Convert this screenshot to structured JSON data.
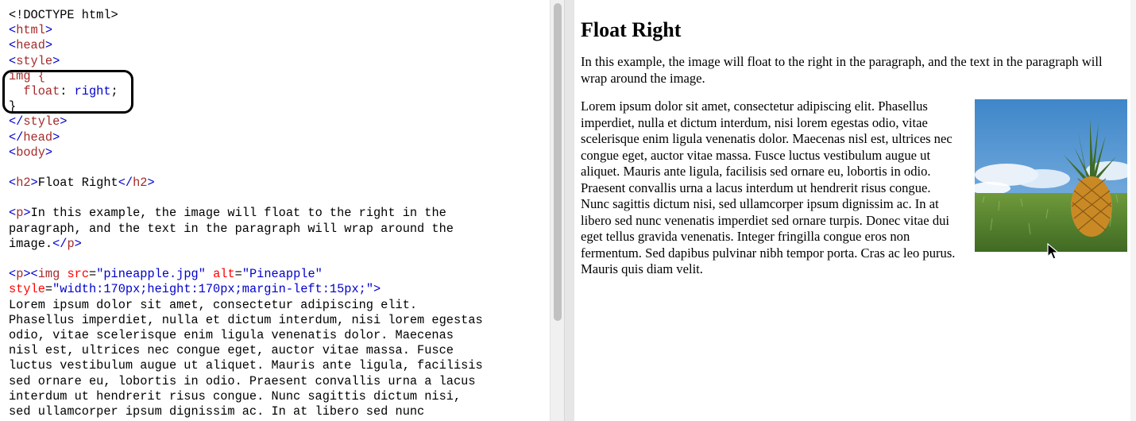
{
  "editor": {
    "lines": [
      [
        [
          "plain",
          "<!DOCTYPE html>"
        ]
      ],
      [
        [
          "br",
          "<"
        ],
        [
          "tag",
          "html"
        ],
        [
          "br",
          ">"
        ]
      ],
      [
        [
          "br",
          "<"
        ],
        [
          "tag",
          "head"
        ],
        [
          "br",
          ">"
        ]
      ],
      [
        [
          "br",
          "<"
        ],
        [
          "tag",
          "style"
        ],
        [
          "br",
          ">"
        ]
      ],
      [
        [
          "sel",
          "img {"
        ]
      ],
      [
        [
          "plain",
          "  "
        ],
        [
          "prop",
          "float"
        ],
        [
          "plain",
          ": "
        ],
        [
          "val",
          "right"
        ],
        [
          "plain",
          ";"
        ]
      ],
      [
        [
          "plain",
          "}"
        ]
      ],
      [
        [
          "br",
          "</"
        ],
        [
          "tag",
          "style"
        ],
        [
          "br",
          ">"
        ]
      ],
      [
        [
          "br",
          "</"
        ],
        [
          "tag",
          "head"
        ],
        [
          "br",
          ">"
        ]
      ],
      [
        [
          "br",
          "<"
        ],
        [
          "tag",
          "body"
        ],
        [
          "br",
          ">"
        ]
      ],
      [],
      [
        [
          "br",
          "<"
        ],
        [
          "tag",
          "h2"
        ],
        [
          "br",
          ">"
        ],
        [
          "plain",
          "Float Right"
        ],
        [
          "br",
          "</"
        ],
        [
          "tag",
          "h2"
        ],
        [
          "br",
          ">"
        ]
      ],
      [],
      [
        [
          "br",
          "<"
        ],
        [
          "tag",
          "p"
        ],
        [
          "br",
          ">"
        ],
        [
          "plain",
          "In this example, the image will float to the right in the"
        ]
      ],
      [
        [
          "plain",
          "paragraph, and the text in the paragraph will wrap around the"
        ]
      ],
      [
        [
          "plain",
          "image."
        ],
        [
          "br",
          "</"
        ],
        [
          "tag",
          "p"
        ],
        [
          "br",
          ">"
        ]
      ],
      [],
      [
        [
          "br",
          "<"
        ],
        [
          "tag",
          "p"
        ],
        [
          "br",
          "><"
        ],
        [
          "tag",
          "img"
        ],
        [
          "plain",
          " "
        ],
        [
          "attr",
          "src"
        ],
        [
          "plain",
          "="
        ],
        [
          "str",
          "\"pineapple.jpg\""
        ],
        [
          "plain",
          " "
        ],
        [
          "attr",
          "alt"
        ],
        [
          "plain",
          "="
        ],
        [
          "str",
          "\"Pineapple\""
        ]
      ],
      [
        [
          "attr",
          "style"
        ],
        [
          "plain",
          "="
        ],
        [
          "str",
          "\"width:170px;height:170px;margin-left:15px;\""
        ],
        [
          "br",
          ">"
        ]
      ],
      [
        [
          "plain",
          "Lorem ipsum dolor sit amet, consectetur adipiscing elit."
        ]
      ],
      [
        [
          "plain",
          "Phasellus imperdiet, nulla et dictum interdum, nisi lorem egestas"
        ]
      ],
      [
        [
          "plain",
          "odio, vitae scelerisque enim ligula venenatis dolor. Maecenas"
        ]
      ],
      [
        [
          "plain",
          "nisl est, ultrices nec congue eget, auctor vitae massa. Fusce"
        ]
      ],
      [
        [
          "plain",
          "luctus vestibulum augue ut aliquet. Mauris ante ligula, facilisis"
        ]
      ],
      [
        [
          "plain",
          "sed ornare eu, lobortis in odio. Praesent convallis urna a lacus"
        ]
      ],
      [
        [
          "plain",
          "interdum ut hendrerit risus congue. Nunc sagittis dictum nisi,"
        ]
      ],
      [
        [
          "plain",
          "sed ullamcorper ipsum dignissim ac. In at libero sed nunc"
        ]
      ]
    ]
  },
  "result": {
    "heading": "Float Right",
    "intro": "In this example, the image will float to the right in the paragraph, and the text in the paragraph will wrap around the image.",
    "lorem": "Lorem ipsum dolor sit amet, consectetur adipiscing elit. Phasellus imperdiet, nulla et dictum interdum, nisi lorem egestas odio, vitae scelerisque enim ligula venenatis dolor. Maecenas nisl est, ultrices nec congue eget, auctor vitae massa. Fusce luctus vestibulum augue ut aliquet. Mauris ante ligula, facilisis sed ornare eu, lobortis in odio. Praesent convallis urna a lacus interdum ut hendrerit risus congue. Nunc sagittis dictum nisi, sed ullamcorper ipsum dignissim ac. In at libero sed nunc venenatis imperdiet sed ornare turpis. Donec vitae dui eget tellus gravida venenatis. Integer fringilla congue eros non fermentum. Sed dapibus pulvinar nibh tempor porta. Cras ac leo purus. Mauris quis diam velit.",
    "image_icon": "pineapple-photo"
  }
}
